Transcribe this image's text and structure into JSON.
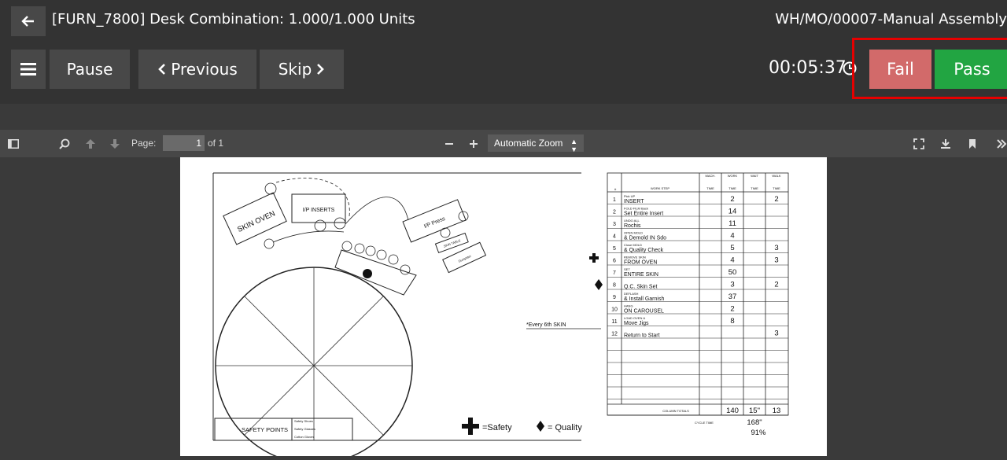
{
  "header": {
    "title": "[FURN_7800] Desk Combination: 1.000/1.000 Units",
    "reference": "WH/MO/00007-Manual Assembly"
  },
  "controls": {
    "pause_label": "Pause",
    "previous_label": "Previous",
    "skip_label": "Skip",
    "timer": "00:05:37",
    "fail_label": "Fail",
    "pass_label": "Pass"
  },
  "viewer": {
    "page_label": "Page:",
    "page_value": "1",
    "page_count": "of 1",
    "zoom_value": "Automatic Zoom"
  },
  "worksheet": {
    "headers": {
      "num": "#",
      "step": "WORK STEP",
      "mach": "MACH.",
      "mach2": "TIME",
      "work": "WORK",
      "work2": "TIME",
      "wait": "WAIT",
      "wait2": "TIME",
      "walk": "WALK",
      "walk2": "TIME"
    },
    "rows": [
      {
        "n": "1",
        "step1": "Pick UP",
        "step2": "INSERT",
        "work": "2",
        "wait": "",
        "walk": "2"
      },
      {
        "n": "2",
        "step1": "FOLD FILM Back",
        "step2": "Set Entire Insert",
        "work": "14",
        "wait": "",
        "walk": ""
      },
      {
        "n": "3",
        "step1": "UNDO ALL",
        "step2": "Rochis",
        "work": "11",
        "wait": "",
        "walk": ""
      },
      {
        "n": "4",
        "step1": "OPEN MOLD",
        "step2": "& Demold IN Sdo",
        "work": "4",
        "wait": "",
        "walk": ""
      },
      {
        "n": "5",
        "step1": "Close MOLD",
        "step2": "& Quality Check",
        "work": "5",
        "wait": "",
        "walk": "3"
      },
      {
        "n": "6",
        "step1": "REMOVE SKIN",
        "step2": "FROM OVEN",
        "work": "4",
        "wait": "",
        "walk": "3"
      },
      {
        "n": "7",
        "step1": "SET",
        "step2": "ENTIRE SKIN",
        "work": "50",
        "wait": "",
        "walk": ""
      },
      {
        "n": "8",
        "step1": "",
        "step2": "Q.C. Skin Set",
        "work": "3",
        "wait": "",
        "walk": "2"
      },
      {
        "n": "9",
        "step1": "DEFLASH",
        "step2": "& Install Garnish",
        "work": "37",
        "wait": "",
        "walk": ""
      },
      {
        "n": "10",
        "step1": "HANG",
        "step2": "ON CAROUSEL",
        "work": "2",
        "wait": "",
        "walk": ""
      },
      {
        "n": "11",
        "step1": "LOAD OVEN &",
        "step2": "Move Jigs",
        "work": "8",
        "wait": "",
        "walk": ""
      },
      {
        "n": "12",
        "step1": "",
        "step2": "Return to Start",
        "work": "",
        "wait": "",
        "walk": "3"
      }
    ],
    "column_totals_label": "COLUMN TOTALS",
    "totals": {
      "work": "140",
      "wait": "15\"",
      "walk": "13"
    },
    "cycle_time_label": "CYCLE TIME",
    "cycle_time": "168\"",
    "efficiency": "91%"
  },
  "diagram": {
    "skin_oven": "SKIN OVEN",
    "ip_inserts": "I/P INSERTS",
    "ip_press": "I/P Press",
    "dumpster": "Dumpster",
    "small_table": "SKIN TABLE",
    "every_note": "*Every 6th SKIN",
    "safety_points_label": "SAFETY POINTS",
    "safety_items": [
      "Safety Shoes",
      "Safety Glasses",
      "Cotton Gloves"
    ],
    "legend_safety": "=Safety",
    "legend_quality": "= Quality"
  }
}
